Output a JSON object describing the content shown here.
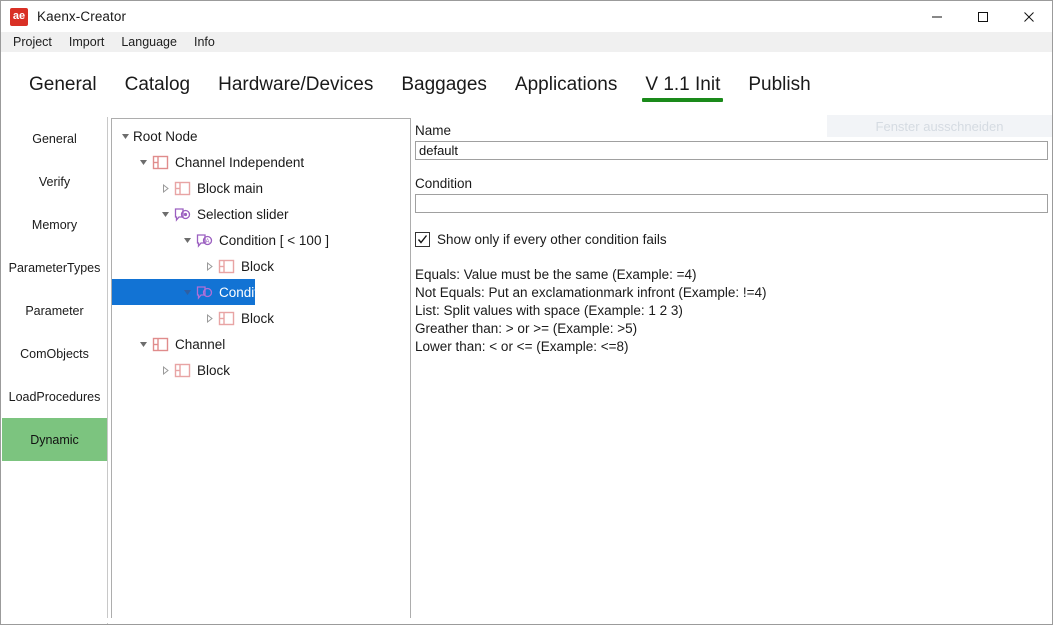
{
  "window": {
    "title": "Kaenx-Creator",
    "icon_text": "ae",
    "icon_name": "app-icon",
    "controls": [
      {
        "name": "minimize-button",
        "glyph": "minimize"
      },
      {
        "name": "maximize-button",
        "glyph": "maximize"
      },
      {
        "name": "close-button",
        "glyph": "close"
      }
    ]
  },
  "menubar": {
    "items": [
      {
        "label": "Project"
      },
      {
        "label": "Import"
      },
      {
        "label": "Language"
      },
      {
        "label": "Info"
      }
    ]
  },
  "tabs": {
    "active_index": 5,
    "accent_color": "#1a8a1a",
    "items": [
      {
        "label": "General"
      },
      {
        "label": "Catalog"
      },
      {
        "label": "Hardware/Devices"
      },
      {
        "label": "Baggages"
      },
      {
        "label": "Applications"
      },
      {
        "label": "V 1.1 Init"
      },
      {
        "label": "Publish"
      }
    ]
  },
  "overlay": {
    "ghost_text": "Fenster ausschneiden"
  },
  "sidebar": {
    "selected_index": 7,
    "selected_color": "#7cc47f",
    "items": [
      {
        "label": "General"
      },
      {
        "label": "Verify"
      },
      {
        "label": "Memory"
      },
      {
        "label": "ParameterTypes"
      },
      {
        "label": "Parameter"
      },
      {
        "label": "ComObjects"
      },
      {
        "label": "LoadProcedures"
      },
      {
        "label": "Dynamic"
      }
    ]
  },
  "tree": {
    "selection_color": "#1273d4",
    "block_icon_color": "#e08c8c",
    "choose_icon_color": "#9b5fc0",
    "nodes": [
      {
        "label": "Root Node",
        "depth": 0,
        "twist": "expanded",
        "icon": "none"
      },
      {
        "label": "Channel Independent",
        "depth": 1,
        "twist": "expanded",
        "icon": "block-icon"
      },
      {
        "label": "Block main",
        "depth": 2,
        "twist": "collapsed",
        "icon": "block-icon"
      },
      {
        "label": "Selection  slider",
        "depth": 2,
        "twist": "expanded",
        "icon": "choose-icon"
      },
      {
        "label": "Condition  [ < 100 ]",
        "depth": 3,
        "twist": "expanded",
        "icon": "when-icon"
      },
      {
        "label": "Block",
        "depth": 4,
        "twist": "collapsed",
        "icon": "block-icon"
      },
      {
        "label": "Condition default [ ]",
        "depth": 3,
        "twist": "expanded",
        "icon": "when-icon",
        "selected": true
      },
      {
        "label": "Block",
        "depth": 4,
        "twist": "collapsed",
        "icon": "block-icon"
      },
      {
        "label": "Channel",
        "depth": 1,
        "twist": "expanded",
        "icon": "block-icon"
      },
      {
        "label": "Block",
        "depth": 2,
        "twist": "collapsed",
        "icon": "block-icon"
      }
    ]
  },
  "detail": {
    "name_label": "Name",
    "name_value": "default",
    "name_placeholder": "",
    "condition_label": "Condition",
    "condition_value": "",
    "condition_placeholder": "",
    "checkbox_label": "Show only if every other condition fails",
    "checkbox_checked": true,
    "help_lines": [
      "Equals: Value must be the same (Example: =4)",
      "Not Equals: Put an exclamationmark infront (Example: !=4)",
      "List: Split values with space (Example: 1 2 3)",
      "Greather than: > or >= (Example: >5)",
      "Lower than: < or <= (Example: <=8)"
    ]
  }
}
